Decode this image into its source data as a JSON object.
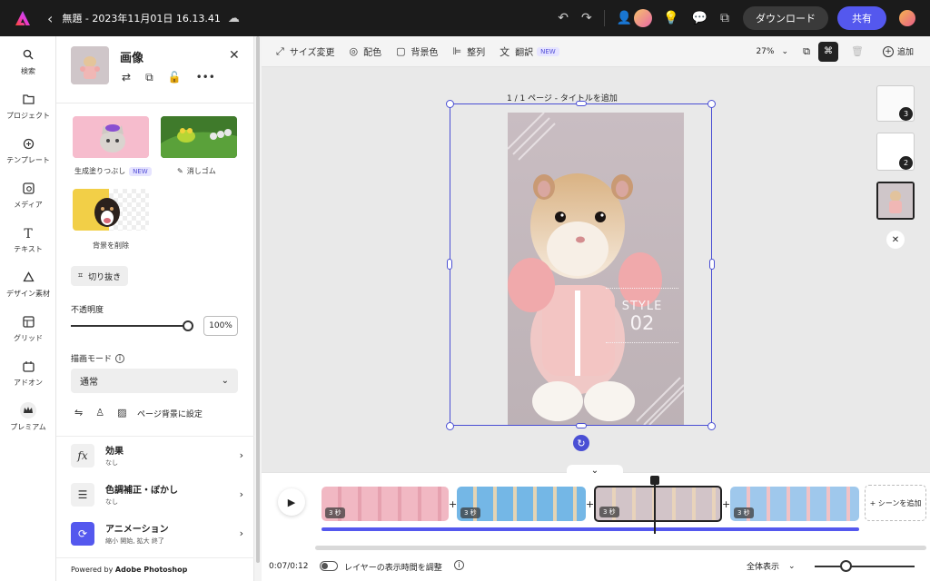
{
  "topbar": {
    "doc_title": "無題 - 2023年11月01日 16.13.41",
    "download_label": "ダウンロード",
    "share_label": "共有"
  },
  "leftnav": {
    "items": [
      {
        "label": "検索",
        "icon": "search-icon"
      },
      {
        "label": "プロジェクト",
        "icon": "folder-icon"
      },
      {
        "label": "テンプレート",
        "icon": "template-icon"
      },
      {
        "label": "メディア",
        "icon": "media-icon"
      },
      {
        "label": "テキスト",
        "icon": "text-icon"
      },
      {
        "label": "デザイン素材",
        "icon": "shapes-icon"
      },
      {
        "label": "グリッド",
        "icon": "grid-icon"
      },
      {
        "label": "アドオン",
        "icon": "addon-icon"
      },
      {
        "label": "プレミアム",
        "icon": "crown-icon"
      }
    ]
  },
  "panel": {
    "title": "画像",
    "thumbs": [
      {
        "label": "生成塗りつぶし",
        "badge": "NEW"
      },
      {
        "label": "消しゴム"
      },
      {
        "label": "背景を削除"
      }
    ],
    "crop_label": "切り抜き",
    "opacity_label": "不透明度",
    "opacity_value": "100%",
    "blend_label": "描画モード",
    "blend_value": "通常",
    "set_bg_label": "ページ背景に設定",
    "sections": [
      {
        "title": "効果",
        "sub": "なし"
      },
      {
        "title": "色調補正・ぼかし",
        "sub": "なし"
      },
      {
        "title": "アニメーション",
        "sub": "縮小 開始, 拡大 終了"
      }
    ],
    "powered_prefix": "Powered by ",
    "powered_brand": "Adobe Photoshop"
  },
  "toolbar": {
    "resize": "サイズ変更",
    "color": "配色",
    "bg_color": "背景色",
    "align": "整列",
    "translate": "翻訳",
    "new_badge": "NEW",
    "zoom": "27%",
    "add": "追加"
  },
  "canvas": {
    "page_label": "1 / 1 ページ - タイトルを追加",
    "style_title": "STYLE",
    "style_number": "02"
  },
  "pages": {
    "badges": [
      "3",
      "2"
    ]
  },
  "timeline": {
    "clip_durations": [
      "3 秒",
      "3 秒",
      "3 秒",
      "3 秒"
    ],
    "add_scene": "+ シーンを追加",
    "time": "0:07/0:12",
    "layer_toggle_label": "レイヤーの表示時間を調整",
    "view_label": "全体表示"
  },
  "colors": {
    "accent": "#5458ee",
    "selection": "#4a4fd4"
  }
}
